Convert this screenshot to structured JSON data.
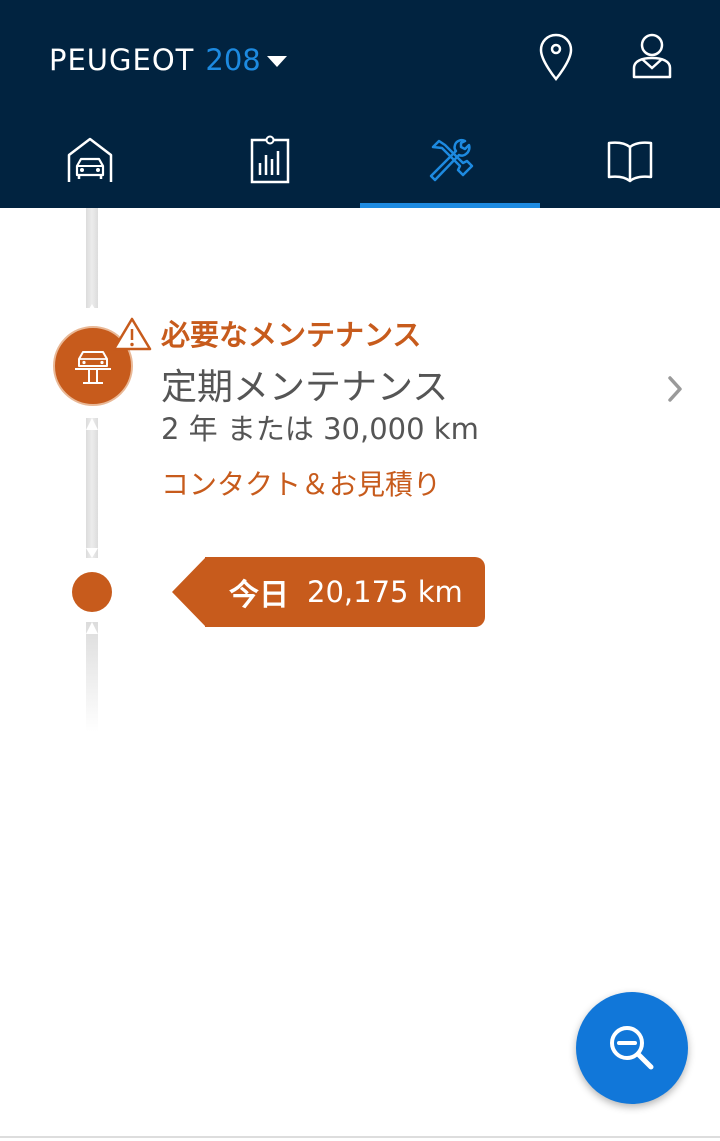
{
  "header": {
    "brand": "PEUGEOT",
    "model": "208",
    "icons": {
      "location": "location-pin-icon",
      "account": "user-account-icon"
    },
    "tabs": [
      {
        "icon": "garage-car-icon",
        "active": false
      },
      {
        "icon": "dashboard-chart-icon",
        "active": false
      },
      {
        "icon": "maintenance-tools-icon",
        "active": true
      },
      {
        "icon": "manual-book-icon",
        "active": false
      }
    ]
  },
  "maintenance": {
    "status": "必要なメンテナンス",
    "title": "定期メンテナンス",
    "interval": "2 年 または 30,000 km",
    "contact_link": "コンタクト＆お見積り",
    "node_icon": "car-lift-icon",
    "status_icon": "warning-icon"
  },
  "today": {
    "label": "今日",
    "mileage": "20,175 km"
  },
  "fab": {
    "icon": "zoom-out-icon"
  },
  "colors": {
    "header_bg": "#012340",
    "accent_blue": "#1d8ae0",
    "maintenance_orange": "#c75b1c",
    "fab_blue": "#1177d9"
  }
}
